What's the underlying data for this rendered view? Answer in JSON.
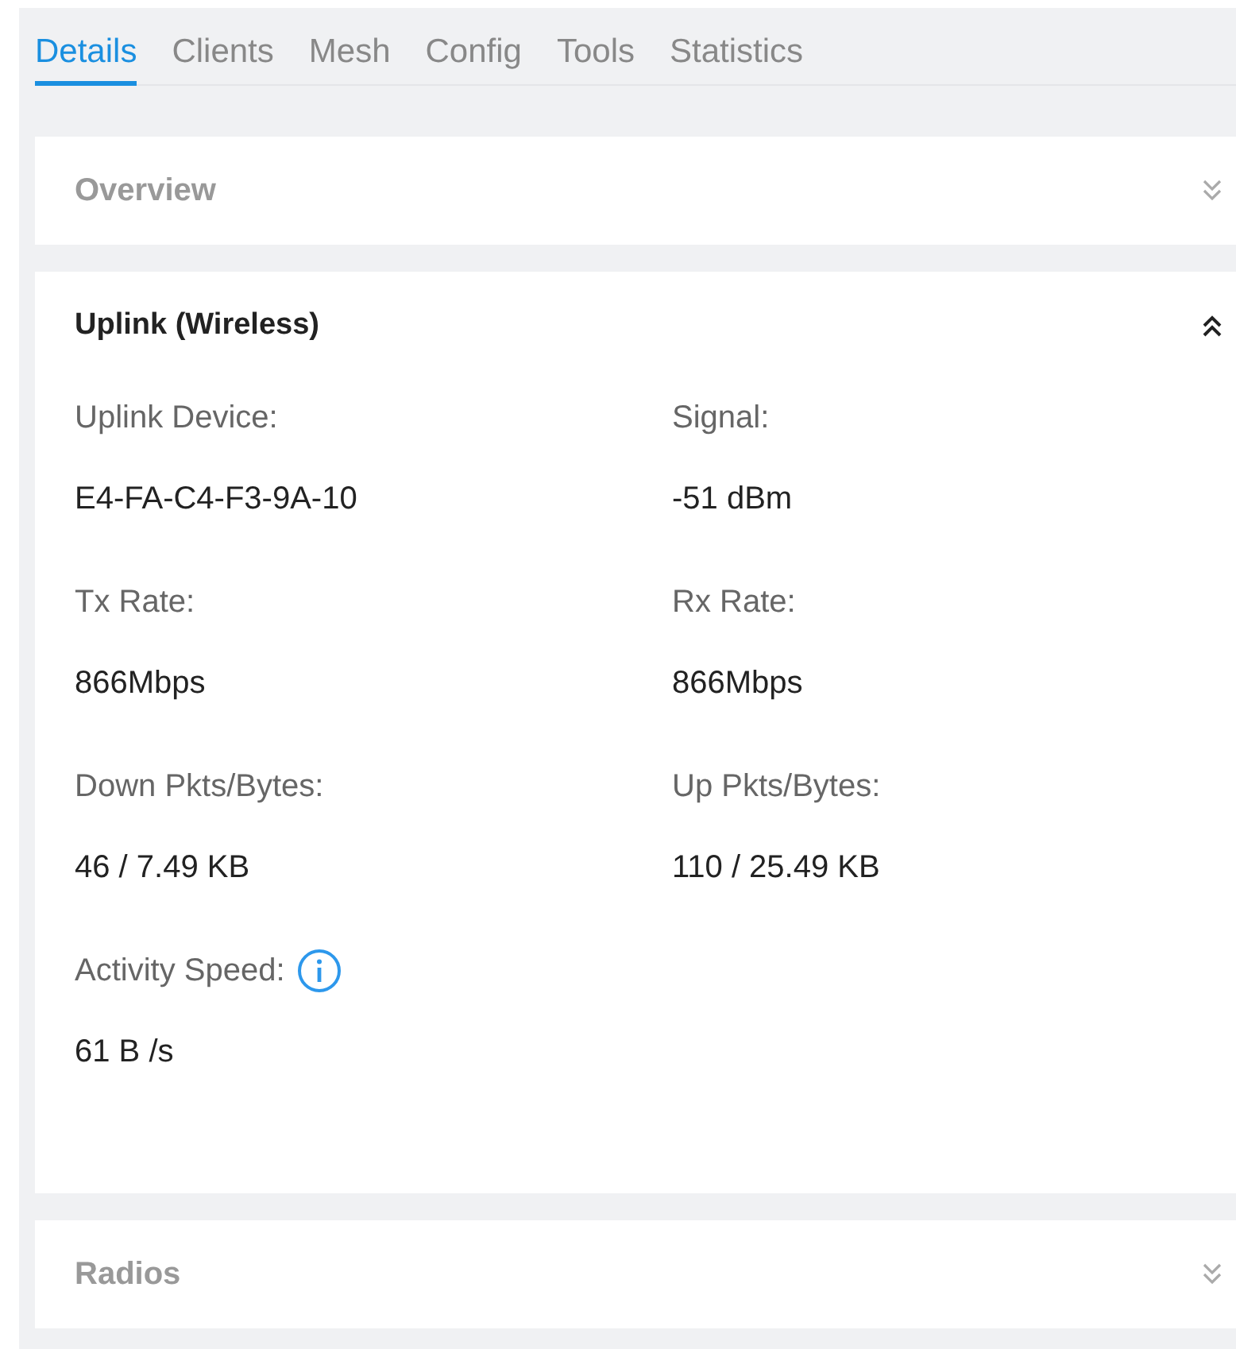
{
  "tabs": [
    {
      "label": "Details",
      "selected": true
    },
    {
      "label": "Clients",
      "selected": false
    },
    {
      "label": "Mesh",
      "selected": false
    },
    {
      "label": "Config",
      "selected": false
    },
    {
      "label": "Tools",
      "selected": false
    },
    {
      "label": "Statistics",
      "selected": false
    }
  ],
  "sections": [
    {
      "title": "Overview",
      "expanded": false
    },
    {
      "title": "Uplink (Wireless)",
      "expanded": true,
      "fields": [
        {
          "label": "Uplink Device:",
          "value": "E4-FA-C4-F3-9A-10",
          "info": false
        },
        {
          "label": "Signal:",
          "value": "-51 dBm",
          "info": false
        },
        {
          "label": "Tx Rate:",
          "value": "866Mbps",
          "info": false
        },
        {
          "label": "Rx Rate:",
          "value": "866Mbps",
          "info": false
        },
        {
          "label": "Down Pkts/Bytes:",
          "value": "46 / 7.49 KB",
          "info": false
        },
        {
          "label": "Up Pkts/Bytes:",
          "value": "110 / 25.49 KB",
          "info": false
        },
        {
          "label": "Activity Speed:",
          "value": "61 B /s",
          "info": true
        }
      ]
    },
    {
      "title": "Radios",
      "expanded": false
    }
  ]
}
